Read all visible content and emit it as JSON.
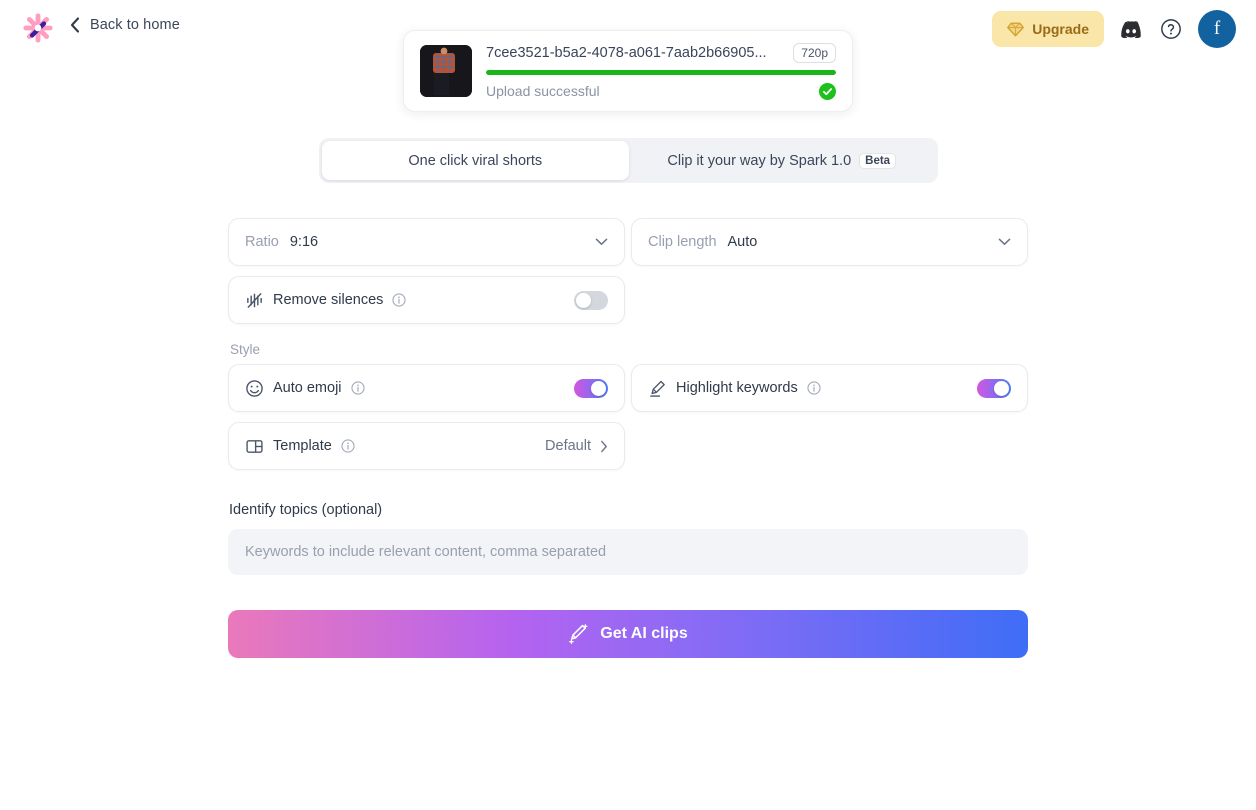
{
  "header": {
    "logo_icon": "sparkle-wand-logo",
    "back_icon": "chevron-left-icon",
    "back_label": "Back to home",
    "upgrade_label": "Upgrade",
    "upgrade_icon": "diamond-icon",
    "upgrade_bg": "#f9e6a8",
    "upgrade_fg": "#9a6b17",
    "discord_icon": "discord-icon",
    "help_icon": "help-circle-icon",
    "avatar_letter": "f",
    "avatar_bg": "#1262a0"
  },
  "upload": {
    "thumbnail_icon": "video-thumbnail",
    "filename": "7cee3521-b5a2-4078-a061-7aab2b66905...",
    "resolution_badge": "720p",
    "progress_percent": 100,
    "progress_color": "#1ab51a",
    "status": "Upload successful",
    "check_icon": "check-circle-icon"
  },
  "tabs": [
    {
      "label": "One click viral shorts",
      "active": true,
      "badge": ""
    },
    {
      "label": "Clip it your way by Spark 1.0",
      "active": false,
      "badge": "Beta"
    }
  ],
  "settings": {
    "ratio": {
      "label": "Ratio",
      "value": "9:16",
      "chevron": "chevron-down-icon"
    },
    "clip_length": {
      "label": "Clip length",
      "value": "Auto",
      "chevron": "chevron-down-icon"
    },
    "remove_silences": {
      "label": "Remove silences",
      "icon": "audio-waveform-muted-icon",
      "info_icon": "info-icon",
      "enabled": false
    }
  },
  "style": {
    "section_label": "Style",
    "auto_emoji": {
      "label": "Auto emoji",
      "icon": "smiley-face-icon",
      "info_icon": "info-icon",
      "enabled": true
    },
    "highlight_keywords": {
      "label": "Highlight keywords",
      "icon": "highlighter-pen-icon",
      "info_icon": "info-icon",
      "enabled": true
    },
    "template": {
      "label": "Template",
      "icon": "layout-panels-icon",
      "info_icon": "info-icon",
      "value": "Default",
      "chevron": "chevron-right-icon"
    },
    "toggle_on_gradient_start": "#d356e0",
    "toggle_on_gradient_end": "#4f7dfb"
  },
  "topics": {
    "label": "Identify topics (optional)",
    "value": "",
    "placeholder": "Keywords to include relevant content, comma separated"
  },
  "cta": {
    "label": "Get AI clips",
    "icon": "magic-wand-sparkle-icon",
    "gradient_start": "#ea79bb",
    "gradient_end": "#3f6df6"
  }
}
